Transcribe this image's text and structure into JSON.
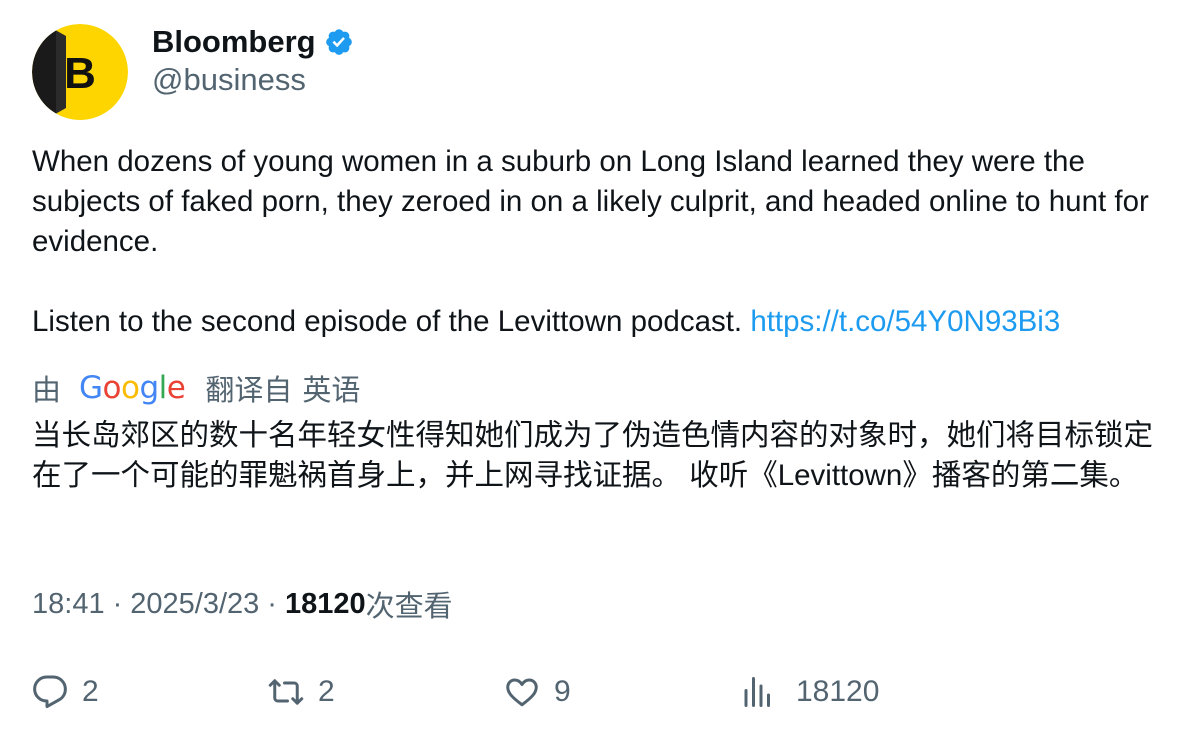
{
  "author": {
    "display_name": "Bloomberg",
    "handle": "@business",
    "avatar_letter": "B",
    "verified": true,
    "verified_icon": "verified-badge-icon"
  },
  "tweet": {
    "text_line1": "When dozens of young women in a suburb on Long Island learned they were the subjects of faked porn, they zeroed in on a likely culprit, and headed online to hunt for evidence.",
    "text_line2": "Listen to the second episode of the Levittown podcast. ",
    "link": "https://t.co/54Y0N93Bi3"
  },
  "translation": {
    "by": "由",
    "provider_letters": [
      "G",
      "o",
      "o",
      "g",
      "l",
      "e"
    ],
    "from_label": "翻译自",
    "language": "英语",
    "text": "当长岛郊区的数十名年轻女性得知她们成为了伪造色情内容的对象时，她们将目标锁定在了一个可能的罪魁祸首身上，并上网寻找证据。 收听《Levittown》播客的第二集。"
  },
  "meta": {
    "time": "18:41",
    "separator": "·",
    "date": "2025/3/23",
    "views_count": "18120",
    "views_label": "次查看"
  },
  "actions": {
    "replies": "2",
    "retweets": "2",
    "likes": "9",
    "views": "18120"
  },
  "colors": {
    "link": "#1d9bf0",
    "muted": "#536471",
    "text": "#0f1419",
    "brand_yellow": "#ffd500"
  }
}
